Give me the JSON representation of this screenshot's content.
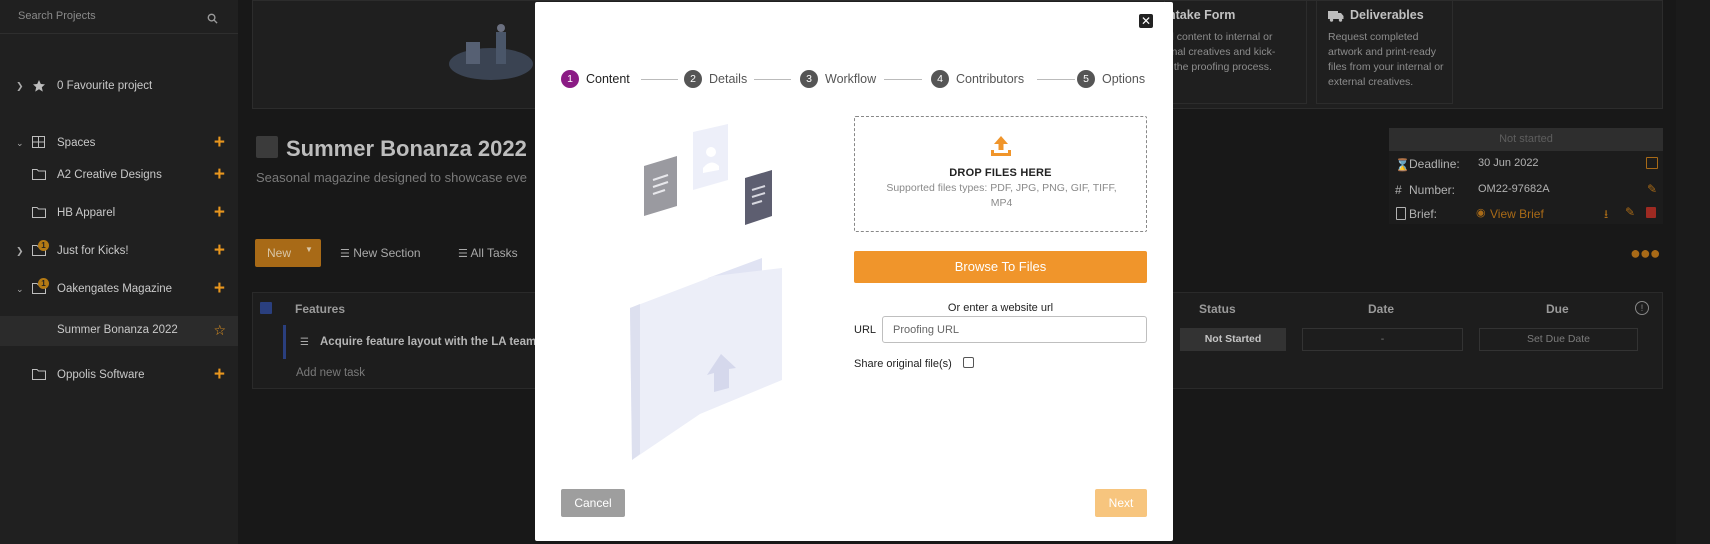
{
  "sidebar": {
    "search_placeholder": "Search Projects",
    "favourites": "0 Favourite project",
    "spaces": "Spaces",
    "items": [
      {
        "label": "A2 Creative Designs"
      },
      {
        "label": "HB Apparel"
      },
      {
        "label": "Just for Kicks!",
        "badge": "1"
      },
      {
        "label": "Oakengates Magazine",
        "badge": "1"
      },
      {
        "label": "Summer Bonanza 2022"
      },
      {
        "label": "Oppolis Software"
      }
    ]
  },
  "background": {
    "card_intake": {
      "title": "ntake Form",
      "text": "d content to internal or\nrnal creatives and kick-\nt the proofing process."
    },
    "card_deliverables": {
      "title": "Deliverables",
      "text": "Request completed\nartwork and print-ready\nfiles from your internal or\nexternal creatives."
    },
    "project_title": "Summer Bonanza 2022",
    "project_subtitle": "Seasonal magazine designed to showcase eve",
    "toolbar": {
      "new": "New",
      "new_section": "New Section",
      "all_tasks": "All Tasks"
    },
    "table": {
      "col_features": "Features",
      "col_status": "Status",
      "col_date": "Date",
      "col_due": "Due",
      "task": "Acquire feature layout with the LA team",
      "status": "Not Started",
      "date": "-",
      "due_placeholder": "Set Due Date",
      "add_task": "Add new task"
    },
    "info": {
      "status": "Not started",
      "deadline_label": "Deadline:",
      "deadline_value": "30 Jun 2022",
      "number_label": "Number:",
      "number_value": "OM22-97682A",
      "brief_label": "Brief:",
      "brief_link": "View Brief"
    }
  },
  "modal": {
    "steps": [
      {
        "num": "1",
        "label": "Content"
      },
      {
        "num": "2",
        "label": "Details"
      },
      {
        "num": "3",
        "label": "Workflow"
      },
      {
        "num": "4",
        "label": "Contributors"
      },
      {
        "num": "5",
        "label": "Options"
      }
    ],
    "current_step": 1,
    "drop_title": "DROP FILES HERE",
    "drop_sub": "Supported files types: PDF, JPG, PNG, GIF, TIFF, MP4",
    "browse": "Browse To Files",
    "or_url": "Or enter a website url",
    "url_label": "URL",
    "url_placeholder": "Proofing URL",
    "share_label": "Share original file(s)",
    "share_checked": false,
    "cancel": "Cancel",
    "next": "Next"
  },
  "colors": {
    "accent": "#f0952b",
    "step_active": "#8b1b85",
    "next_disabled": "#f7c57e",
    "cancel": "#9e9e9e"
  }
}
